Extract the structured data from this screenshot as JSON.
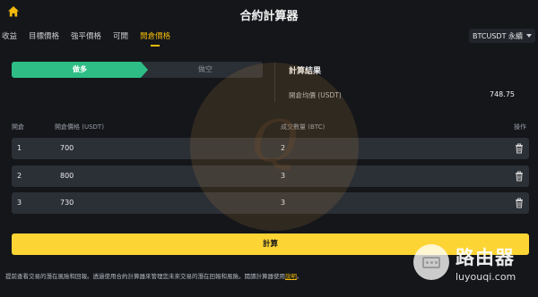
{
  "header": {
    "title": "合約計算器"
  },
  "tabs": [
    {
      "label": "收益"
    },
    {
      "label": "目標價格"
    },
    {
      "label": "強平價格"
    },
    {
      "label": "可開"
    },
    {
      "label": "開倉價格"
    }
  ],
  "active_tab": "開倉價格",
  "pair_selector": {
    "label": "BTCUSDT 永續"
  },
  "side": {
    "long_label": "做多",
    "short_label": "做空",
    "selected": "做多"
  },
  "result": {
    "title": "計算結果",
    "avg_label": "開倉均價 (USDT)",
    "avg_value": "748.75"
  },
  "table": {
    "headers": {
      "index": "開倉",
      "price": "開倉價格 (USDT)",
      "qty": "成交數量 (BTC)",
      "action": "操作"
    },
    "rows": [
      {
        "index": "1",
        "price": "700",
        "qty": "2"
      },
      {
        "index": "2",
        "price": "800",
        "qty": "3"
      },
      {
        "index": "3",
        "price": "730",
        "qty": "3"
      }
    ]
  },
  "calculate_label": "計算",
  "footer": {
    "note": "提前查看交易的潛在風險和回報。透過使用合約計算器來管理您未來交易的潛在回報和風險。閱讀計算器使用",
    "link": "說明",
    "end": "。"
  },
  "watermark": {
    "text": "Q"
  },
  "brand": {
    "name": "路由器",
    "url": "luyouqi.com"
  },
  "colors": {
    "accent": "#f0b90b",
    "long": "#2ebd85",
    "button": "#fcd535",
    "background": "#14161a",
    "field": "#2b2f36"
  },
  "icons": {
    "home": "home-icon",
    "trash": "trash-icon",
    "dropdown": "caret-down-icon"
  }
}
